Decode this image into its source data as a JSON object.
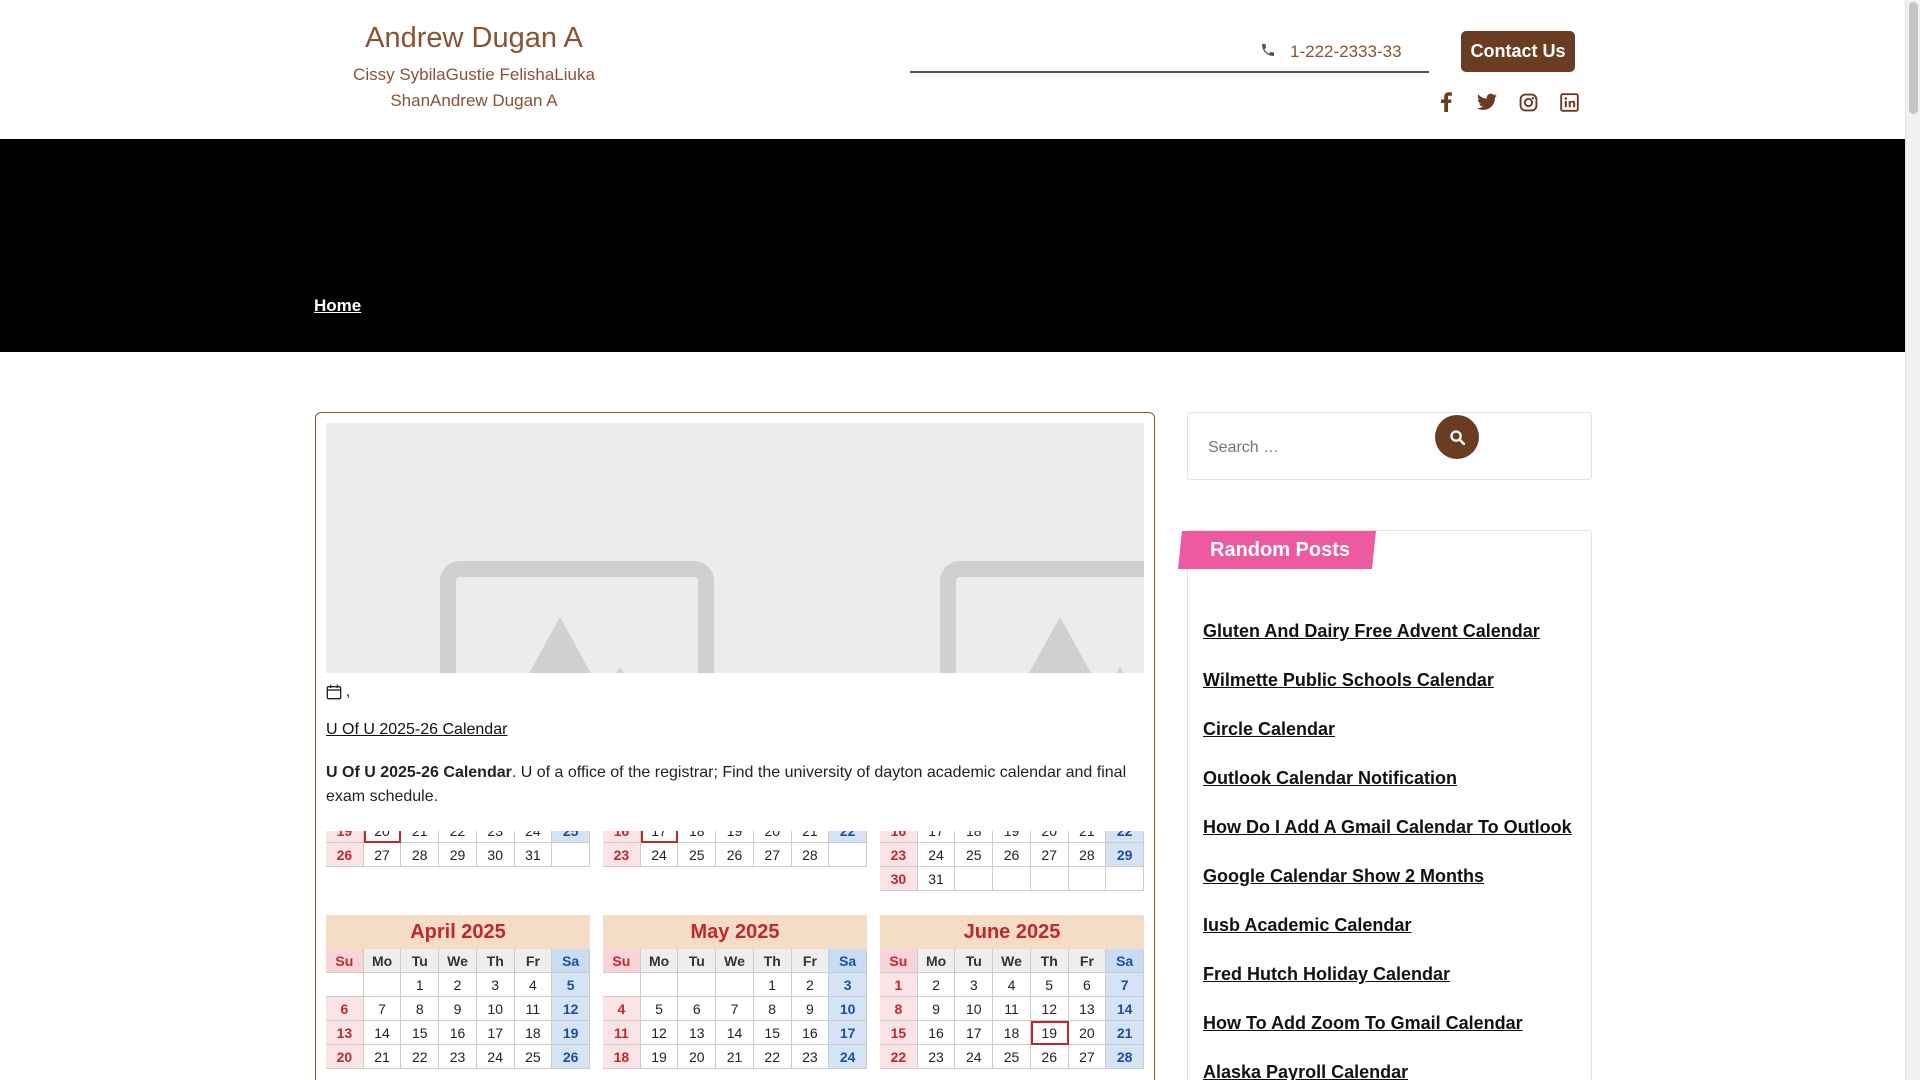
{
  "header": {
    "site_title": "Andrew Dugan A",
    "tagline": "Cissy SybilaGustie FelishaLiuka ShanAndrew Dugan A",
    "phone": "1-222-2333-33",
    "contact_label": "Contact Us",
    "socials": [
      "facebook-icon",
      "twitter-icon",
      "instagram-icon",
      "linkedin-icon"
    ]
  },
  "hero": {
    "breadcrumb": "Home"
  },
  "post": {
    "meta_separator": ",",
    "title": "U Of U 2025-26 Calendar",
    "excerpt_bold": "U Of U 2025-26 Calendar",
    "excerpt_rest": ". U of a office of the registrar; Find the university of dayton academic calendar and final exam schedule."
  },
  "calendar_image": {
    "day_headers": [
      "Su",
      "Mo",
      "Tu",
      "We",
      "Th",
      "Fr",
      "Sa"
    ],
    "top_rows": [
      {
        "rows": [
          [
            "19",
            "20",
            "21",
            "22",
            "23",
            "24",
            "25"
          ],
          [
            "26",
            "27",
            "28",
            "29",
            "30",
            "31",
            ""
          ]
        ],
        "marked": "20"
      },
      {
        "rows": [
          [
            "16",
            "17",
            "18",
            "19",
            "20",
            "21",
            "22"
          ],
          [
            "23",
            "24",
            "25",
            "26",
            "27",
            "28",
            ""
          ]
        ],
        "marked": "17"
      },
      {
        "rows": [
          [
            "16",
            "17",
            "18",
            "19",
            "20",
            "21",
            "22"
          ],
          [
            "23",
            "24",
            "25",
            "26",
            "27",
            "28",
            "29"
          ],
          [
            "30",
            "31",
            "",
            "",
            "",
            "",
            ""
          ]
        ],
        "marked": ""
      }
    ],
    "months": [
      {
        "name": "April 2025",
        "rows": [
          [
            "",
            "",
            "1",
            "2",
            "3",
            "4",
            "5"
          ],
          [
            "6",
            "7",
            "8",
            "9",
            "10",
            "11",
            "12"
          ],
          [
            "13",
            "14",
            "15",
            "16",
            "17",
            "18",
            "19"
          ],
          [
            "20",
            "21",
            "22",
            "23",
            "24",
            "25",
            "26"
          ]
        ],
        "marked": ""
      },
      {
        "name": "May 2025",
        "rows": [
          [
            "",
            "",
            "",
            "",
            "1",
            "2",
            "3"
          ],
          [
            "4",
            "5",
            "6",
            "7",
            "8",
            "9",
            "10"
          ],
          [
            "11",
            "12",
            "13",
            "14",
            "15",
            "16",
            "17"
          ],
          [
            "18",
            "19",
            "20",
            "21",
            "22",
            "23",
            "24"
          ]
        ],
        "marked": ""
      },
      {
        "name": "June 2025",
        "rows": [
          [
            "1",
            "2",
            "3",
            "4",
            "5",
            "6",
            "7"
          ],
          [
            "8",
            "9",
            "10",
            "11",
            "12",
            "13",
            "14"
          ],
          [
            "15",
            "16",
            "17",
            "18",
            "19",
            "20",
            "21"
          ],
          [
            "22",
            "23",
            "24",
            "25",
            "26",
            "27",
            "28"
          ]
        ],
        "marked": "19"
      }
    ]
  },
  "sidebar": {
    "search_placeholder": "Search …",
    "widget_title": "Random Posts",
    "random_posts": [
      "Gluten And Dairy Free Advent Calendar",
      "Wilmette Public Schools Calendar",
      "Circle Calendar",
      "Outlook Calendar Notification",
      "How Do I Add A Gmail Calendar To Outlook",
      "Google Calendar Show 2 Months",
      "Iusb Academic Calendar",
      "Fred Hutch Holiday Calendar",
      "How To Add Zoom To Gmail Calendar",
      "Alaska Payroll Calendar"
    ]
  },
  "colors": {
    "brand_brown": "#8a5232",
    "button_brown": "#6a3d22",
    "widget_pink": "#ee5aa0",
    "hero_black": "#000000"
  }
}
